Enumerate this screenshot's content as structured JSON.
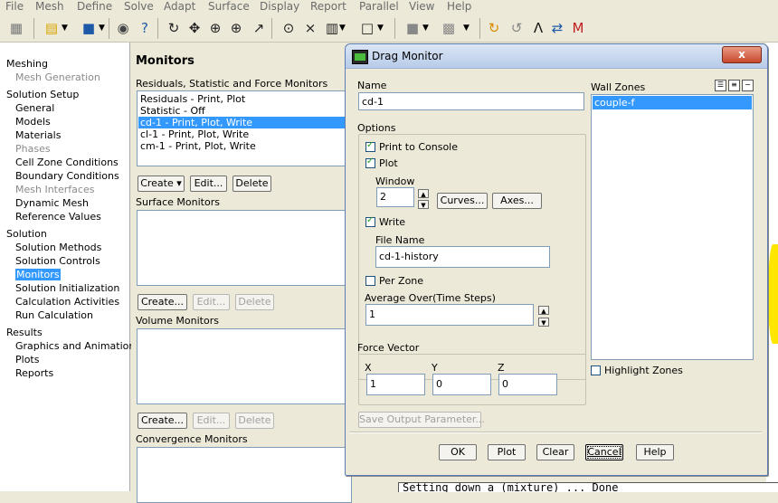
{
  "menu": [
    "File",
    "Mesh",
    "Define",
    "Solve",
    "Adapt",
    "Surface",
    "Display",
    "Report",
    "Parallel",
    "View",
    "Help"
  ],
  "toolbar_icons": [
    "mesh-icon",
    "open-icon",
    "save-icon",
    "camera-icon",
    "help-icon",
    "rotate-icon",
    "move-icon",
    "zoom-in-icon",
    "zoom-icon",
    "probe-icon",
    "zoom-fit-icon",
    "axes-icon",
    "layout-icon",
    "window-icon",
    "grid-icon",
    "cube-icon",
    "refresh-icon",
    "reload-icon",
    "ansys-icon",
    "transfer-icon",
    "mo-icon"
  ],
  "tree": {
    "items": [
      {
        "label": "Meshing",
        "level": 0,
        "state": "normal"
      },
      {
        "label": "Mesh Generation",
        "level": 1,
        "state": "disabled"
      },
      {
        "label": "Solution Setup",
        "level": 0,
        "state": "normal"
      },
      {
        "label": "General",
        "level": 1,
        "state": "normal"
      },
      {
        "label": "Models",
        "level": 1,
        "state": "normal"
      },
      {
        "label": "Materials",
        "level": 1,
        "state": "normal"
      },
      {
        "label": "Phases",
        "level": 1,
        "state": "disabled"
      },
      {
        "label": "Cell Zone Conditions",
        "level": 1,
        "state": "normal"
      },
      {
        "label": "Boundary Conditions",
        "level": 1,
        "state": "normal"
      },
      {
        "label": "Mesh Interfaces",
        "level": 1,
        "state": "disabled"
      },
      {
        "label": "Dynamic Mesh",
        "level": 1,
        "state": "normal"
      },
      {
        "label": "Reference Values",
        "level": 1,
        "state": "normal"
      },
      {
        "label": "Solution",
        "level": 0,
        "state": "normal"
      },
      {
        "label": "Solution Methods",
        "level": 1,
        "state": "normal"
      },
      {
        "label": "Solution Controls",
        "level": 1,
        "state": "normal"
      },
      {
        "label": "Monitors",
        "level": 1,
        "state": "selected"
      },
      {
        "label": "Solution Initialization",
        "level": 1,
        "state": "normal"
      },
      {
        "label": "Calculation Activities",
        "level": 1,
        "state": "normal"
      },
      {
        "label": "Run Calculation",
        "level": 1,
        "state": "normal"
      },
      {
        "label": "Results",
        "level": 0,
        "state": "normal"
      },
      {
        "label": "Graphics and Animations",
        "level": 1,
        "state": "normal"
      },
      {
        "label": "Plots",
        "level": 1,
        "state": "normal"
      },
      {
        "label": "Reports",
        "level": 1,
        "state": "normal"
      }
    ]
  },
  "monitors": {
    "title": "Monitors",
    "residuals_label": "Residuals, Statistic and Force Monitors",
    "residuals_items": [
      {
        "text": "Residuals - Print, Plot",
        "selected": false
      },
      {
        "text": "Statistic - Off",
        "selected": false
      },
      {
        "text": "cd-1 - Print, Plot, Write",
        "selected": true
      },
      {
        "text": "cl-1 - Print, Plot, Write",
        "selected": false
      },
      {
        "text": "cm-1 - Print, Plot, Write",
        "selected": false
      }
    ],
    "create_label": "Create",
    "create_dots_label": "Create...",
    "edit_label": "Edit...",
    "delete_label": "Delete",
    "surface_label": "Surface Monitors",
    "volume_label": "Volume Monitors",
    "convergence_label": "Convergence Monitors"
  },
  "console_text": "Setting down a (mixture) ... Done",
  "dialog": {
    "title": "Drag Monitor",
    "close_label": "x",
    "name_label": "Name",
    "name_value": "cd-1",
    "options_label": "Options",
    "print_label": "Print to Console",
    "print_checked": true,
    "plot_label": "Plot",
    "plot_checked": true,
    "window_label": "Window",
    "window_value": "2",
    "curves_label": "Curves...",
    "axes_label": "Axes...",
    "write_label": "Write",
    "write_checked": true,
    "file_name_label": "File Name",
    "file_name_value": "cd-1-history",
    "per_zone_label": "Per Zone",
    "per_zone_checked": false,
    "average_label": "Average Over(Time Steps)",
    "average_value": "1",
    "force_vector_label": "Force Vector",
    "x_label": "X",
    "x_value": "1",
    "y_label": "Y",
    "y_value": "0",
    "z_label": "Z",
    "z_value": "0",
    "save_output_label": "Save Output Parameter...",
    "wall_zones_label": "Wall Zones",
    "wall_zones": [
      {
        "text": "couple-f",
        "selected": true
      }
    ],
    "highlight_label": "Highlight Zones",
    "highlight_checked": false,
    "ok_label": "OK",
    "plot_button_label": "Plot",
    "clear_label": "Clear",
    "cancel_label": "Cancel",
    "help_label": "Help"
  }
}
